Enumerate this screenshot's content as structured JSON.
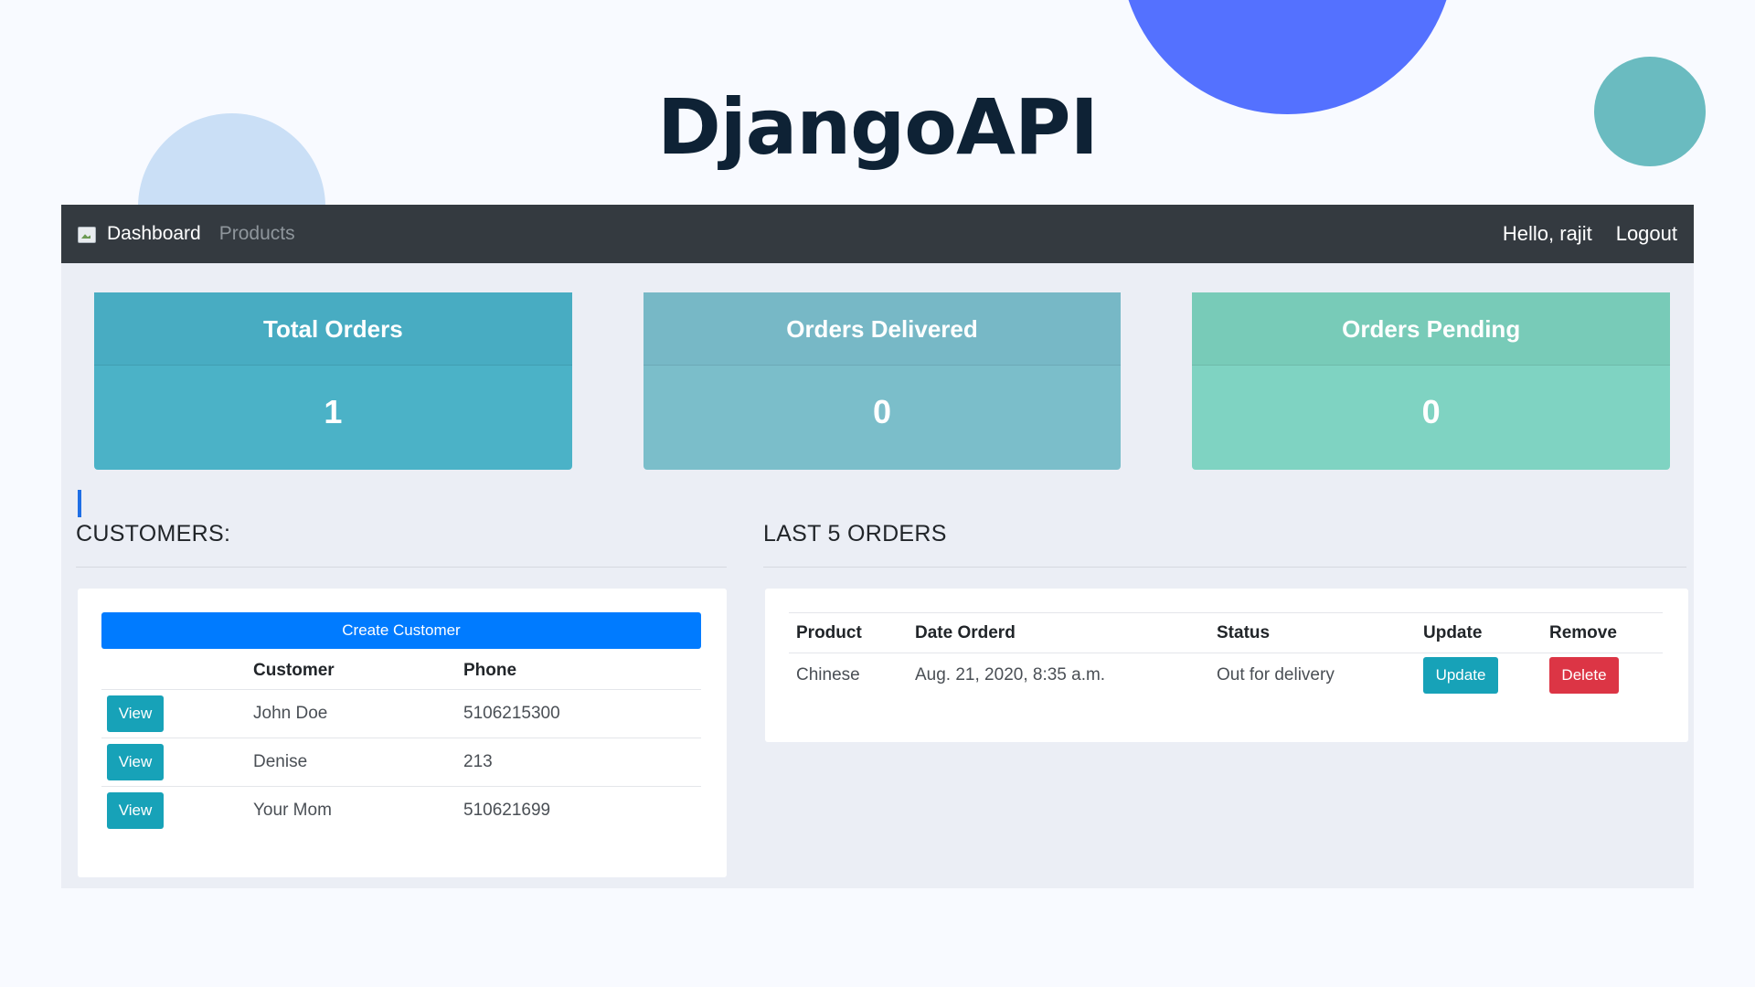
{
  "slide": {
    "title": "DjangoAPI"
  },
  "navbar": {
    "brand_label": "Dashboard",
    "products_link": "Products",
    "greeting": "Hello, rajit",
    "logout": "Logout"
  },
  "stats": {
    "total_orders": {
      "label": "Total Orders",
      "value": "1"
    },
    "orders_delivered": {
      "label": "Orders Delivered",
      "value": "0"
    },
    "orders_pending": {
      "label": "Orders Pending",
      "value": "0"
    }
  },
  "customers": {
    "heading": "CUSTOMERS:",
    "create_button": "Create Customer",
    "columns": [
      "",
      "Customer",
      "Phone"
    ],
    "rows": [
      {
        "action": "View",
        "name": "John Doe",
        "phone": "5106215300"
      },
      {
        "action": "View",
        "name": "Denise",
        "phone": "213"
      },
      {
        "action": "View",
        "name": "Your Mom",
        "phone": "510621699"
      }
    ]
  },
  "orders": {
    "heading": "LAST 5 ORDERS",
    "columns": [
      "Product",
      "Date Orderd",
      "Status",
      "Update",
      "Remove"
    ],
    "rows": [
      {
        "product": "Chinese",
        "date": "Aug. 21, 2020, 8:35 a.m.",
        "status": "Out for delivery",
        "update": "Update",
        "remove": "Delete"
      }
    ]
  },
  "colors": {
    "navbar_bg": "#343a40",
    "primary": "#007bff",
    "info": "#17a2b8",
    "danger": "#dc3545",
    "accent_circle": "#5471ff"
  }
}
